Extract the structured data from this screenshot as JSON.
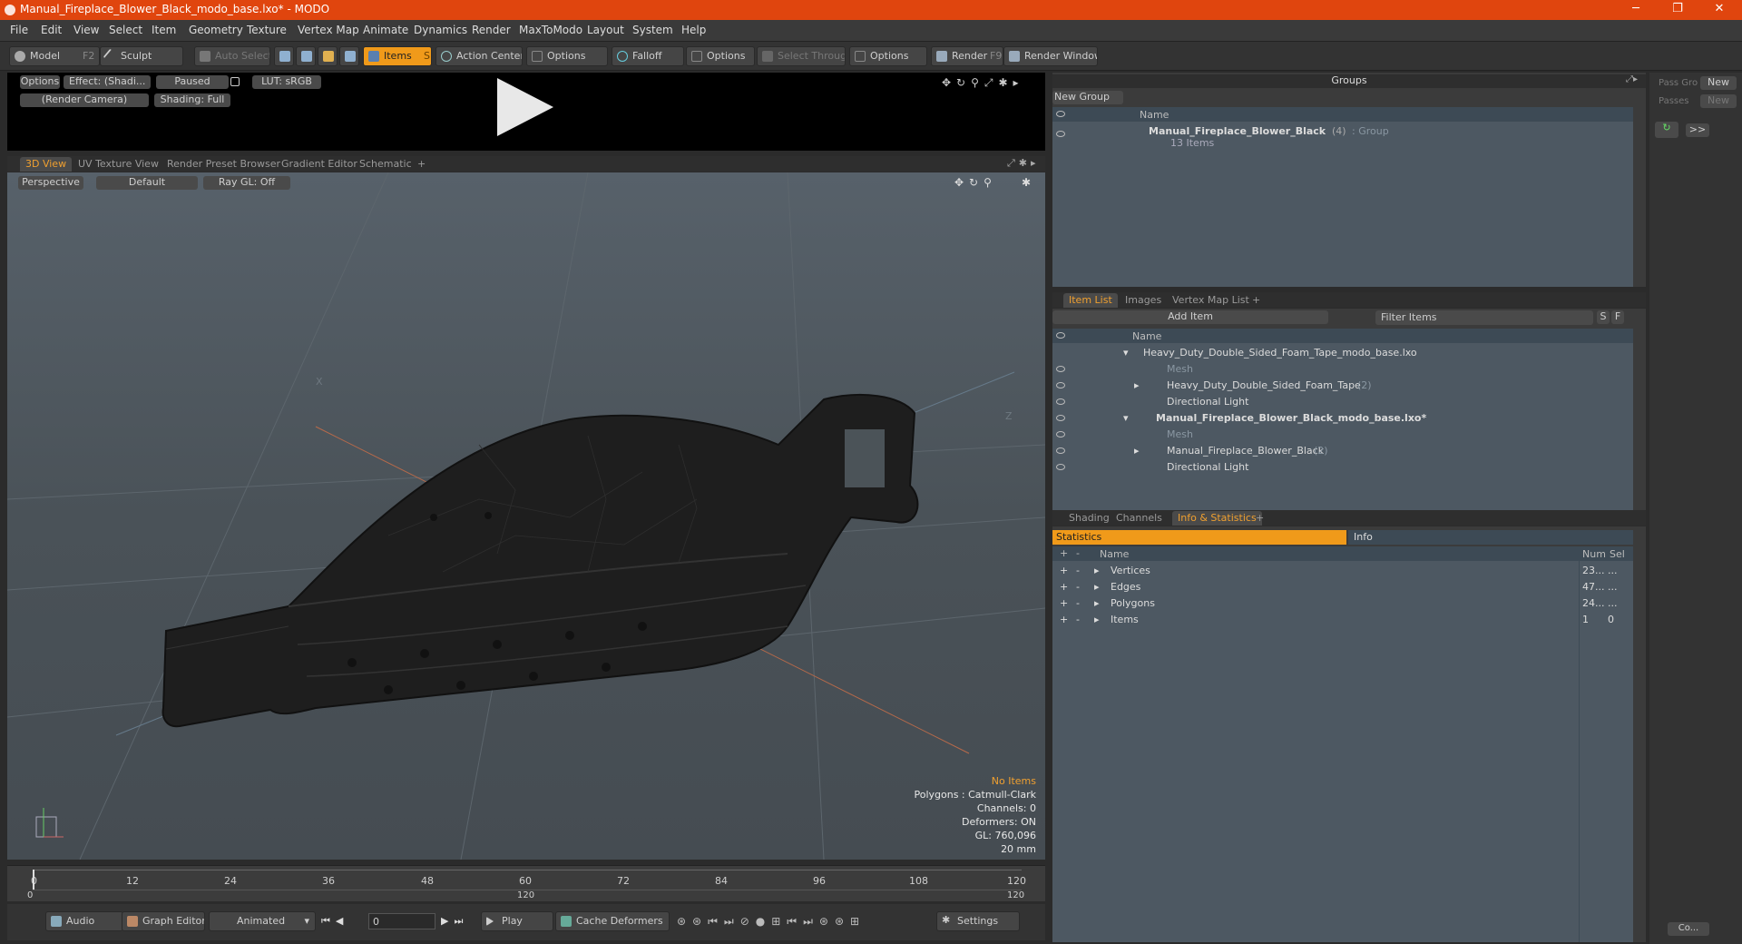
{
  "window": {
    "title": "Manual_Fireplace_Blower_Black_modo_base.lxo* - MODO",
    "min": "─",
    "max": "❐",
    "close": "✕"
  },
  "menu": [
    "File",
    "Edit",
    "View",
    "Select",
    "Item",
    "Geometry",
    "Texture",
    "Vertex Map",
    "Animate",
    "Dynamics",
    "Render",
    "MaxToModo",
    "Layout",
    "System",
    "Help"
  ],
  "toolbar": {
    "model": "Model",
    "model_key": "F2",
    "sculpt": "Sculpt",
    "auto_select": "Auto Select",
    "items": "Items",
    "items_key": "S",
    "action_center": "Action Center",
    "options1": "Options",
    "falloff": "Falloff",
    "options2": "Options",
    "select_through": "Select Through",
    "options3": "Options",
    "render": "Render",
    "render_key": "F9",
    "render_window": "Render Window"
  },
  "preview": {
    "options": "Options",
    "effect": "Effect: (Shadi...",
    "paused": "Paused",
    "lut": "LUT: sRGB",
    "camera": "(Render Camera)",
    "shading": "Shading: Full"
  },
  "viewport_tabs": [
    "3D View",
    "UV Texture View",
    "Render Preset Browser",
    "Gradient Editor",
    "Schematic"
  ],
  "viewport": {
    "perspective": "Perspective",
    "default": "Default",
    "raygl": "Ray GL: Off",
    "x_label": "X",
    "z_label": "Z",
    "overlay": {
      "no_items": "No Items",
      "polygons": "Polygons : Catmull-Clark",
      "channels": "Channels: 0",
      "deformers": "Deformers: ON",
      "gl": "GL: 760,096",
      "size": "20 mm"
    }
  },
  "timeline": {
    "ticks": [
      "0",
      "12",
      "24",
      "36",
      "48",
      "60",
      "72",
      "84",
      "96",
      "108",
      "120"
    ],
    "sub": {
      "start": "0",
      "mid": "120",
      "end": "120"
    }
  },
  "bottombar": {
    "audio": "Audio",
    "graph_editor": "Graph Editor",
    "animated": "Animated",
    "frame": "0",
    "play": "Play",
    "cache": "Cache Deformers",
    "settings": "Settings"
  },
  "groups": {
    "title": "Groups",
    "new_group": "New Group",
    "name_col": "Name",
    "item_name": "Manual_Fireplace_Blower_Black",
    "item_count": "(4)",
    "item_type": ": Group",
    "item_sub": "13 Items"
  },
  "pass": {
    "pass_label": "Pass Gro",
    "new": "New",
    "passes_label": "Passes",
    "new2": "New",
    "more": ">>",
    "co": "Co..."
  },
  "itemlist": {
    "tabs": [
      "Item List",
      "Images",
      "Vertex Map List"
    ],
    "add_item": "Add Item",
    "filter": "Filter Items",
    "s": "S",
    "f": "F",
    "name_col": "Name",
    "rows": [
      {
        "label": "Heavy_Duty_Double_Sided_Foam_Tape_modo_base.lxo",
        "count": "",
        "dim": false,
        "bold": false
      },
      {
        "label": "Mesh",
        "count": "",
        "dim": true,
        "bold": false
      },
      {
        "label": "Heavy_Duty_Double_Sided_Foam_Tape",
        "count": "(2)",
        "dim": false,
        "bold": false
      },
      {
        "label": "Directional Light",
        "count": "",
        "dim": false,
        "bold": false
      },
      {
        "label": "Manual_Fireplace_Blower_Black_modo_base.lxo*",
        "count": "",
        "dim": false,
        "bold": true
      },
      {
        "label": "Mesh",
        "count": "",
        "dim": true,
        "bold": false
      },
      {
        "label": "Manual_Fireplace_Blower_Black",
        "count": "(2)",
        "dim": false,
        "bold": false
      },
      {
        "label": "Directional Light",
        "count": "",
        "dim": false,
        "bold": false
      }
    ]
  },
  "info": {
    "tabs": [
      "Shading",
      "Channels",
      "Info & Statistics"
    ],
    "statistics": "Statistics",
    "info": "Info",
    "cols": {
      "name": "Name",
      "num": "Num",
      "sel": "Sel"
    },
    "rows": [
      {
        "name": "Vertices",
        "num": "23...",
        "sel": "..."
      },
      {
        "name": "Edges",
        "num": "47...",
        "sel": "..."
      },
      {
        "name": "Polygons",
        "num": "24...",
        "sel": "..."
      },
      {
        "name": "Items",
        "num": "1",
        "sel": "0"
      }
    ]
  },
  "colors": {
    "accent": "#f09a1a",
    "titlebar": "#e0450e",
    "viewport": "#4b5358"
  }
}
